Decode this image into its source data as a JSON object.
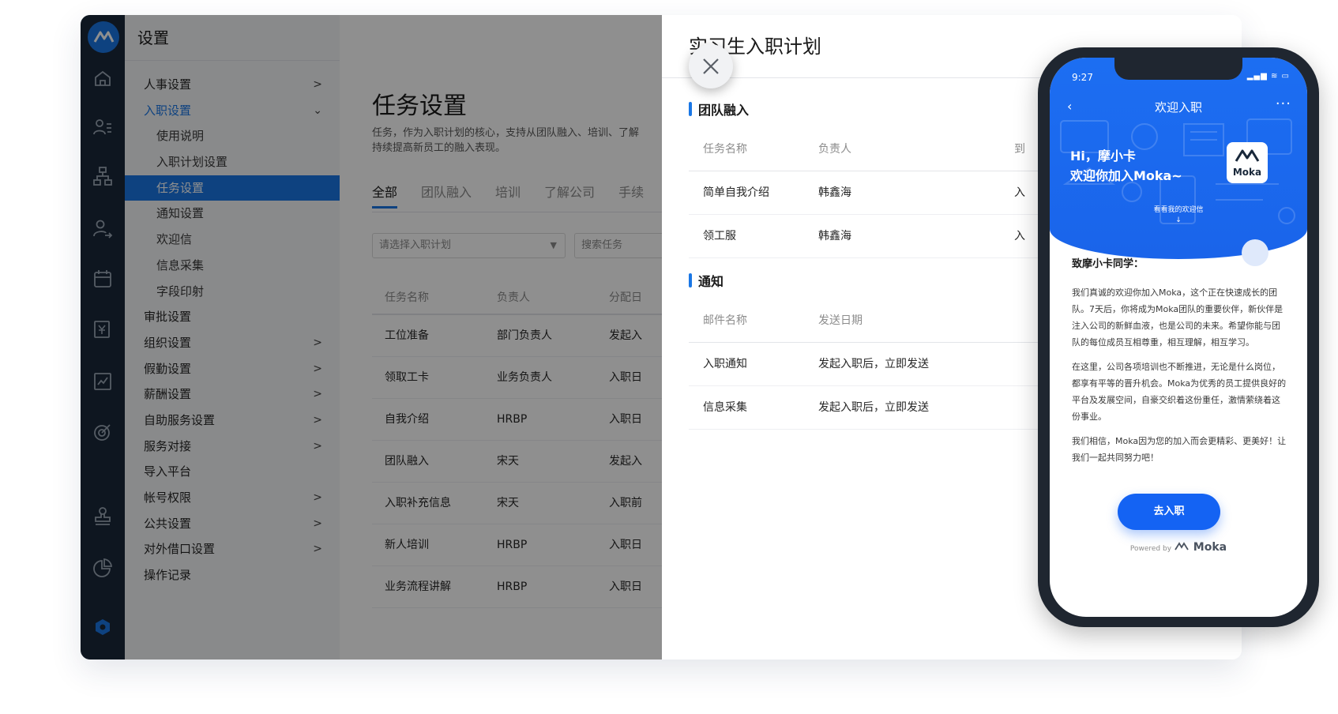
{
  "sidebar_menu": {
    "title": "设置",
    "items": [
      {
        "label": "人事设置",
        "chevron": ">",
        "level": 1
      },
      {
        "label": "入职设置",
        "chevron": "⌄",
        "level": 1,
        "state": "open"
      },
      {
        "label": "使用说明",
        "level": 2
      },
      {
        "label": "入职计划设置",
        "level": 2
      },
      {
        "label": "任务设置",
        "level": 2,
        "state": "selected"
      },
      {
        "label": "通知设置",
        "level": 2
      },
      {
        "label": "欢迎信",
        "level": 2
      },
      {
        "label": "信息采集",
        "level": 2
      },
      {
        "label": "字段印射",
        "level": 2
      },
      {
        "label": "审批设置",
        "level": 1
      },
      {
        "label": "组织设置",
        "chevron": ">",
        "level": 1
      },
      {
        "label": "假勤设置",
        "chevron": ">",
        "level": 1
      },
      {
        "label": "薪酬设置",
        "chevron": ">",
        "level": 1
      },
      {
        "label": "自助服务设置",
        "chevron": ">",
        "level": 1
      },
      {
        "label": "服务对接",
        "chevron": ">",
        "level": 1
      },
      {
        "label": "导入平台",
        "level": 1
      },
      {
        "label": "帐号权限",
        "chevron": ">",
        "level": 1
      },
      {
        "label": "公共设置",
        "chevron": ">",
        "level": 1
      },
      {
        "label": "对外借口设置",
        "chevron": ">",
        "level": 1
      },
      {
        "label": "操作记录",
        "level": 1
      }
    ]
  },
  "rail_icons": [
    "home-icon",
    "employee-list-icon",
    "org-chart-icon",
    "user-transfer-icon",
    "calendar-icon",
    "salary-icon",
    "report-icon",
    "goal-icon",
    "approval-stamp-icon",
    "pie-chart-icon",
    "settings-icon"
  ],
  "task_settings": {
    "title": "任务设置",
    "description": "任务，作为入职计划的核心，支持从团队融入、培训、了解",
    "description_line2": "持续提高新员工的融入表现。",
    "tabs": [
      "全部",
      "团队融入",
      "培训",
      "了解公司",
      "手续"
    ],
    "select_placeholder": "请选择入职计划",
    "search_placeholder": "搜索任务",
    "columns": [
      "任务名称",
      "负责人",
      "分配日"
    ],
    "rows": [
      [
        "工位准备",
        "部门负责人",
        "发起入"
      ],
      [
        "领取工卡",
        "业务负责人",
        "入职日"
      ],
      [
        "自我介绍",
        "HRBP",
        "入职日"
      ],
      [
        "团队融入",
        "宋天",
        "发起入"
      ],
      [
        "入职补充信息",
        "宋天",
        "入职前"
      ],
      [
        "新人培训",
        "HRBP",
        "入职日"
      ],
      [
        "业务流程讲解",
        "HRBP",
        "入职日"
      ]
    ]
  },
  "plan_panel": {
    "title": "实习生入职计划",
    "team_section": {
      "title": "团队融入",
      "columns": [
        "任务名称",
        "负责人",
        "到"
      ],
      "rows": [
        [
          "简单自我介绍",
          "韩鑫海",
          "入"
        ],
        [
          "领工服",
          "韩鑫海",
          "入"
        ]
      ]
    },
    "notice_section": {
      "title": "通知",
      "columns": [
        "邮件名称",
        "发送日期"
      ],
      "rows": [
        [
          "入职通知",
          "发起入职后，立即发送"
        ],
        [
          "信息采集",
          "发起入职后，立即发送"
        ]
      ]
    }
  },
  "phone": {
    "time": "9:27",
    "status": "▂▄▆ ≋ ▭",
    "nav_title": "欢迎入职",
    "back": "‹",
    "more": "···",
    "greeting_line1": "Hi，摩小卡",
    "greeting_line2": "欢迎你加入Moka~",
    "logo_text": "Moka",
    "peek_text": "看看我的欢迎信",
    "peek_arrow": "↓",
    "salutation": "致摩小卡同学：",
    "paragraphs": [
      "我们真诚的欢迎你加入Moka，这个正在快速成长的团队。7天后，你将成为Moka团队的重要伙伴，新伙伴是注入公司的新鲜血液，也是公司的未来。希望你能与团队的每位成员互相尊重，相互理解，相互学习。",
      "在这里，公司各项培训也不断推进，无论是什么岗位，都享有平等的晋升机会。Moka为优秀的员工提供良好的平台及发展空间，自豪交织着这份重任，激情萦绕着这份事业。",
      "我们相信，Moka因为您的加入而会更精彩、更美好！让我们一起共同努力吧！"
    ],
    "cta": "去入职",
    "powered_by": "Powered by",
    "powered_brand": "Moka"
  },
  "colors": {
    "rail_bg": "#19283a",
    "accent": "#1a77e5",
    "phone_blue": "#1c6ef2",
    "overlay": "rgba(0,0,0,0.44)"
  }
}
